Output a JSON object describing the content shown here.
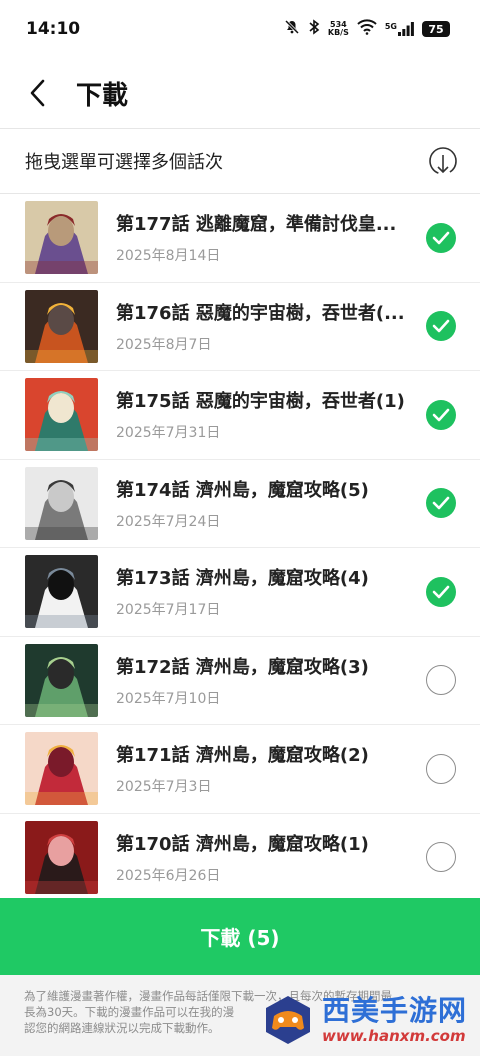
{
  "status_bar": {
    "time": "14:10",
    "net_speed_value": "534",
    "net_speed_unit": "KB/S",
    "signal_label": "5G",
    "battery": "75"
  },
  "header": {
    "title": "下載"
  },
  "hint": {
    "text": "拖曳選單可選擇多個話次"
  },
  "episodes": [
    {
      "title": "第177話 逃離魔窟，準備討伐皇...",
      "date": "2025年8月14日",
      "selected": true
    },
    {
      "title": "第176話 惡魔的宇宙樹，吞世者(...",
      "date": "2025年8月7日",
      "selected": true
    },
    {
      "title": "第175話 惡魔的宇宙樹，吞世者(1)",
      "date": "2025年7月31日",
      "selected": true
    },
    {
      "title": "第174話 濟州島，魔窟攻略(5)",
      "date": "2025年7月24日",
      "selected": true
    },
    {
      "title": "第173話 濟州島，魔窟攻略(4)",
      "date": "2025年7月17日",
      "selected": true
    },
    {
      "title": "第172話 濟州島，魔窟攻略(3)",
      "date": "2025年7月10日",
      "selected": false
    },
    {
      "title": "第171話 濟州島，魔窟攻略(2)",
      "date": "2025年7月3日",
      "selected": false
    },
    {
      "title": "第170話 濟州島，魔窟攻略(1)",
      "date": "2025年6月26日",
      "selected": false
    }
  ],
  "download_button": {
    "label": "下載 (5)"
  },
  "footer": {
    "line1": "為了維護漫畫著作權，漫畫作品每話僅限下載一次，且每次的暫存期間最",
    "line2": "長為30天。下載的漫畫作品可以在我的漫",
    "line3": "認您的網路連線狀況以完成下載動作。"
  },
  "watermark": {
    "name": "西美手游网",
    "url": "www.hanxm.com"
  },
  "colors": {
    "accent_green": "#1fc964",
    "check_green": "#1ec15f",
    "text_dark": "#222222",
    "text_muted": "#9a9a9a"
  }
}
